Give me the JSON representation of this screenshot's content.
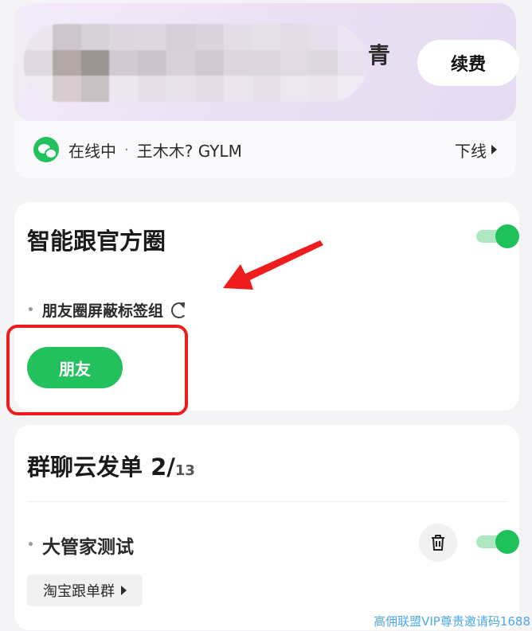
{
  "header": {
    "title_trailing_char": "青",
    "renew_label": "续费"
  },
  "status": {
    "online_text": "在线中",
    "separator": "·",
    "account": "王木木? GYLM",
    "offline_label": "下线"
  },
  "smart_follow": {
    "title": "智能跟官方圈",
    "toggle_on": true,
    "block_label": "朋友圈屏蔽标签组",
    "tag_label": "朋友"
  },
  "group_send": {
    "title": "群聊云发单",
    "count_current": "2/",
    "count_total": "13",
    "item": {
      "name": "大管家测试",
      "toggle_on": true,
      "group_label": "淘宝跟单群"
    }
  },
  "watermark": "高佣联盟VIP尊贵邀请码1688",
  "colors": {
    "accent_green": "#22c15e",
    "annotation_red": "#ee1c1c"
  }
}
